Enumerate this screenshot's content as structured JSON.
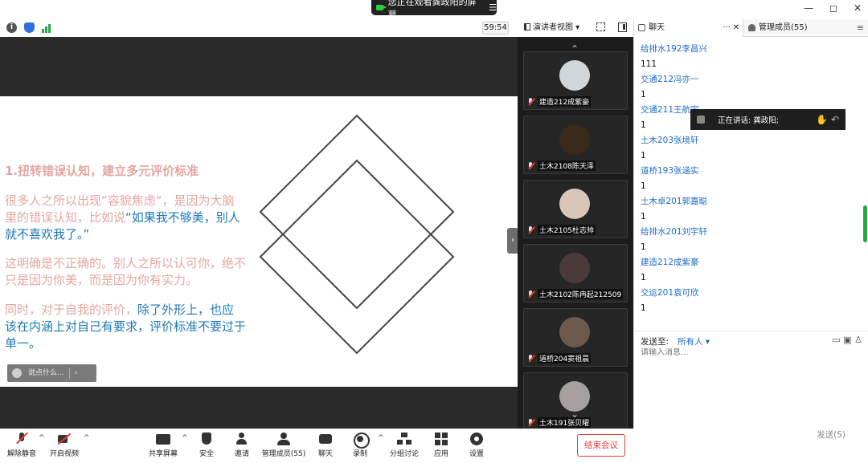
{
  "topbar": {
    "share_status": "您正在观看龚政阳的屏幕",
    "menu_glyph": "☰",
    "min": "—",
    "max": "◻",
    "close": "✕"
  },
  "toolbar": {
    "timer": "59:54",
    "view_label": "演讲者视图",
    "info_glyph": "i"
  },
  "slide": {
    "title": "1.扭转错误认知，建立多元评价标准",
    "p1_a": "很多人之所以出现“容貌焦虑”，是因为大脑里的错误认知，比如说",
    "p1_b": "“如果我不够美，别人就不喜欢我了。”",
    "p2": "这明确是不正确的。别人之所以认可你，绝不只是因为你美，而是因为你有实力。",
    "p3_a": "同时，对于自我的评价，",
    "p3_b": "除了外形上，也应该在内涵上对自己有要求，评价标准不要过于单一。"
  },
  "comment": {
    "placeholder": "说点什么...",
    "arrow": "‹"
  },
  "handle_glyph": "›",
  "videos": {
    "up": "⌃",
    "down": "⌄",
    "tiles": [
      {
        "name": "建造212成紫豪",
        "color": "#cfd6dc"
      },
      {
        "name": "土木2108陈天泽",
        "color": "#3a2a1a"
      },
      {
        "name": "土木2105杜志帅",
        "color": "#d8c7b8"
      },
      {
        "name": "土木2102陈冉起212509",
        "color": "#4a3a3a"
      },
      {
        "name": "道桥204窦祖晨",
        "color": "#6b5a4a"
      },
      {
        "name": "土木191张贝曜",
        "color": "#a8a0a0"
      }
    ]
  },
  "chat": {
    "tab_chat": "聊天",
    "tab_more": "···",
    "tab_close": "✕",
    "tab_members": "管理成员(55)",
    "panel_menu": "≡",
    "messages": [
      {
        "who": "给排水192李昌兴",
        "text": "111"
      },
      {
        "who": "交通212冯亦一",
        "text": "1"
      },
      {
        "who": "交通211王航宇",
        "text": "1"
      },
      {
        "who": "土木203张境轩",
        "text": "1"
      },
      {
        "who": "道桥193张涵实",
        "text": "1"
      },
      {
        "who": "土木卓201郭嘉聪",
        "text": "1"
      },
      {
        "who": "给排水201刘宇轩",
        "text": "1"
      },
      {
        "who": "建造212成紫豪",
        "text": "1"
      },
      {
        "who": "交运201袁可欣",
        "text": "1"
      }
    ],
    "speaking": "正在讲话: 龚政阳;",
    "speaking_icons": "✋ ↶",
    "send_label": "发送至:",
    "send_target": "所有人 ▾",
    "send_icons": "▭ ▣ ♙",
    "input_placeholder": "请输入消息...",
    "send_button": "发送(S)"
  },
  "bottom": {
    "unmute": "解除静音",
    "video": "开启视频",
    "share": "共享屏幕",
    "security": "安全",
    "invite": "邀请",
    "members": "管理成员(55)",
    "chat": "聊天",
    "record": "录制",
    "breakout": "分组讨论",
    "apps": "应用",
    "settings": "设置",
    "end": "结束会议",
    "caret": "^"
  }
}
